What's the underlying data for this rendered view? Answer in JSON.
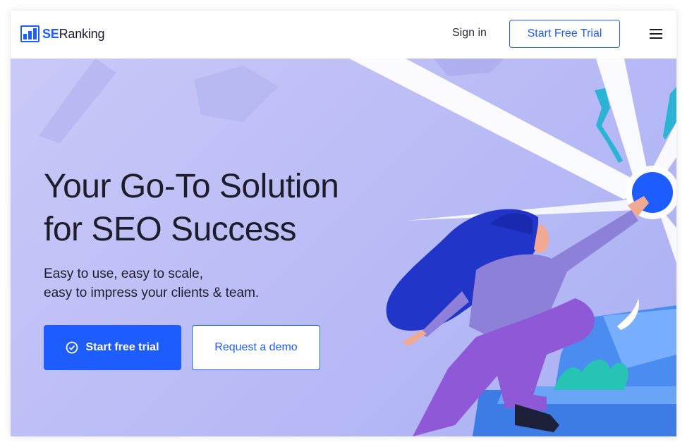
{
  "header": {
    "logo_se": "SE",
    "logo_ranking": "Ranking",
    "signin_label": "Sign in",
    "trial_label": "Start Free Trial"
  },
  "hero": {
    "headline_line1": "Your Go-To Solution",
    "headline_line2": "for SEO Success",
    "sub_line1": "Easy to use, easy to scale,",
    "sub_line2": "easy to impress your clients & team.",
    "primary_cta": "Start free trial",
    "secondary_cta": "Request a demo"
  },
  "icons": {
    "logo": "bar-chart-logo-icon",
    "menu": "hamburger-menu-icon",
    "check": "check-circle-icon"
  },
  "colors": {
    "accent": "#1d5cff",
    "hero_bg": "#bcbdf6",
    "text": "#1d1d2b"
  }
}
